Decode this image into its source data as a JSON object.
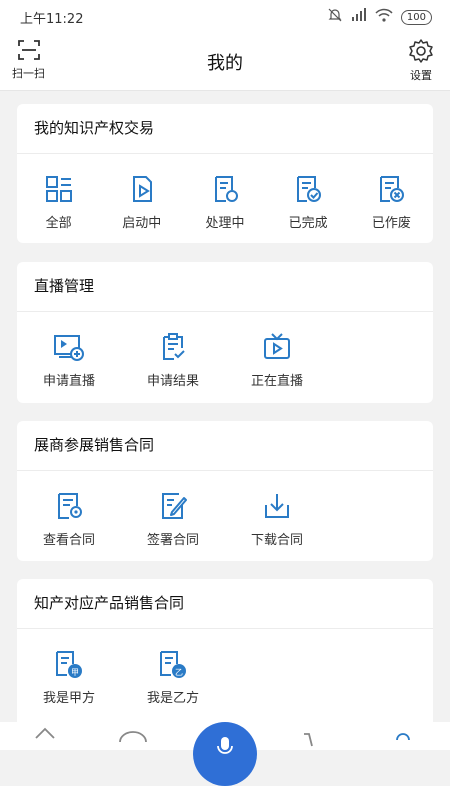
{
  "status": {
    "time": "上午11:22",
    "battery": "100"
  },
  "header": {
    "title": "我的",
    "scan_label": "扫一扫",
    "settings_label": "设置"
  },
  "ip_trade": {
    "title": "我的知识产权交易",
    "items": [
      {
        "label": "全部",
        "icon": "grid-icon"
      },
      {
        "label": "启动中",
        "icon": "doc-play-icon"
      },
      {
        "label": "处理中",
        "icon": "doc-refresh-icon"
      },
      {
        "label": "已完成",
        "icon": "doc-check-icon"
      },
      {
        "label": "已作废",
        "icon": "doc-cancel-icon"
      }
    ]
  },
  "live": {
    "title": "直播管理",
    "items": [
      {
        "label": "申请直播",
        "icon": "apply-live-icon"
      },
      {
        "label": "申请结果",
        "icon": "clipboard-check-icon"
      },
      {
        "label": "正在直播",
        "icon": "tv-icon"
      }
    ]
  },
  "expo": {
    "title": "展商参展销售合同",
    "items": [
      {
        "label": "查看合同",
        "icon": "view-contract-icon"
      },
      {
        "label": "签署合同",
        "icon": "sign-contract-icon"
      },
      {
        "label": "下载合同",
        "icon": "download-icon"
      }
    ]
  },
  "product": {
    "title": "知产对应产品销售合同",
    "items": [
      {
        "label": "我是甲方",
        "icon": "party-a-icon",
        "badge": "甲"
      },
      {
        "label": "我是乙方",
        "icon": "party-b-icon",
        "badge": "乙"
      }
    ]
  },
  "colors": {
    "accent": "#2a7bc6",
    "mic": "#2f6fd6"
  }
}
